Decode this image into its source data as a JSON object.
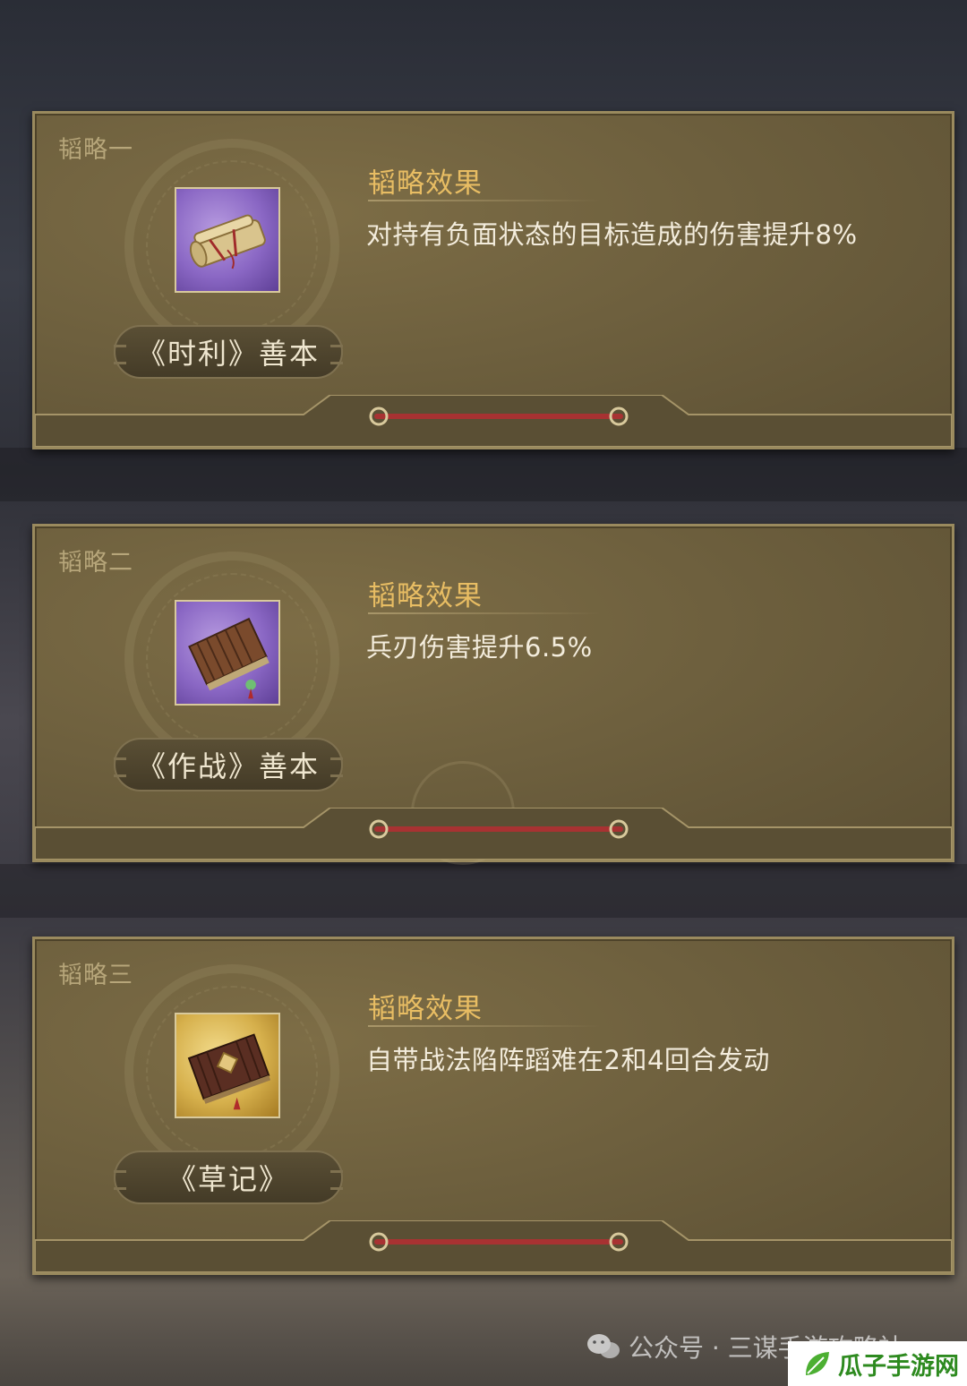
{
  "cards": [
    {
      "slot_label": "韬略一",
      "item_name": "《时利》善本",
      "effect_title": "韬略效果",
      "effect_text": "对持有负面状态的目标造成的伤害提升8%",
      "icon": "scroll-bundle-icon",
      "frame": "purple"
    },
    {
      "slot_label": "韬略二",
      "item_name": "《作战》善本",
      "effect_title": "韬略效果",
      "effect_text": "兵刃伤害提升6.5%",
      "icon": "bamboo-book-icon",
      "frame": "purple"
    },
    {
      "slot_label": "韬略三",
      "item_name": "《草记》",
      "effect_title": "韬略效果",
      "effect_text": "自带战法陷阵蹈难在2和4回合发动",
      "icon": "sealed-book-icon",
      "frame": "gold"
    }
  ],
  "watermark": {
    "text": "公众号 · 三谋手游攻略社",
    "icon": "wechat-icon"
  },
  "site_badge": {
    "text": "瓜子手游网",
    "icon": "leaf-icon"
  },
  "colors": {
    "panel": "#6e603e",
    "effect_title": "#e8bd63",
    "effect_text": "#f3ecdc",
    "slot_label": "#b7a67a",
    "purple_frame": "#8a67c4",
    "gold_frame": "#d6b04c",
    "red_cord": "#a83232"
  }
}
